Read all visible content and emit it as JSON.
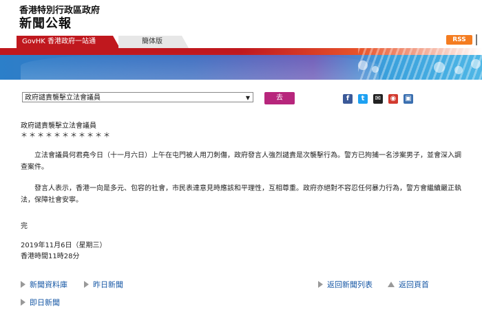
{
  "header": {
    "line1": "香港特別行政區政府",
    "line2": "新聞公報"
  },
  "tabs": [
    {
      "label": "GovHK 香港政府一站通"
    },
    {
      "label": "簡体版"
    }
  ],
  "rss_label": "RSS",
  "selector": {
    "selected": "政府譴責襲擊立法會議員",
    "go_label": "去"
  },
  "share_icons": [
    "facebook-icon",
    "twitter-icon",
    "email-icon",
    "weibo-icon",
    "print-icon"
  ],
  "colors": {
    "brand_red": "#c0181e",
    "go_button": "#b7267c",
    "link_blue": "#1a5aa6",
    "rss_orange": "#f47c20"
  },
  "article": {
    "title": "政府譴責襲擊立法會議員",
    "stars": "＊＊＊＊＊＊＊＊＊＊＊",
    "paragraph1": "立法會議員何君堯今日（十一月六日）上午在屯門被人用刀刺傷，政府發言人強烈譴責是次襲擊行為。警方已拘捕一名涉案男子，並會深入調查案件。",
    "paragraph2": "發言人表示，香港一向是多元、包容的社會，市民表達意見時應該和平理性，互相尊重。政府亦絕對不容忍任何暴力行為，警方會繼續嚴正執法，保障社會安寧。",
    "end": "完",
    "date": "2019年11月6日（星期三）",
    "time": "香港時間11時28分"
  },
  "footer_nav": {
    "archive": "新聞資料庫",
    "yesterday": "昨日新聞",
    "back_list": "返回新聞列表",
    "back_top": "返回頁首",
    "today": "即日新聞"
  }
}
